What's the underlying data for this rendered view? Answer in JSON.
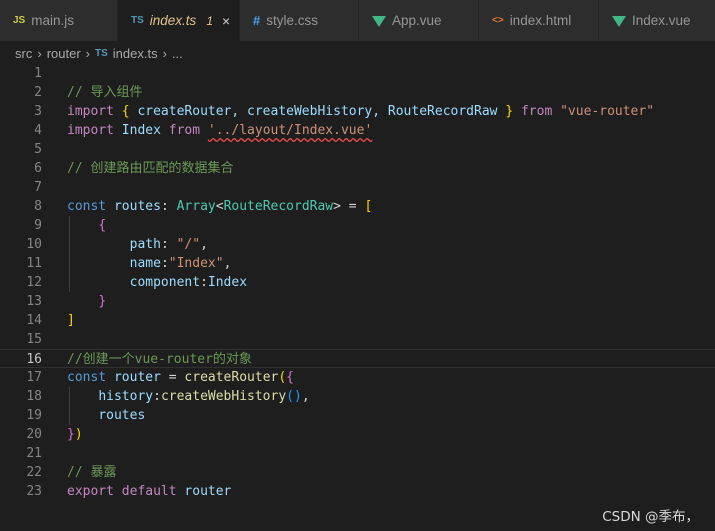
{
  "tabs": [
    {
      "icon": "JS",
      "icon_color": "#cbcb41",
      "label": "main.js",
      "width": 118
    },
    {
      "icon": "TS",
      "icon_color": "#519aba",
      "label": "index.ts",
      "modified": "1",
      "close": "×",
      "active": true,
      "width": 122
    },
    {
      "icon": "#",
      "icon_color": "#42a5f5",
      "label": "style.css",
      "width": 119
    },
    {
      "icon": "vue",
      "icon_color": "#41b883",
      "label": "App.vue",
      "width": 120
    },
    {
      "icon": "<>",
      "icon_color": "#e37933",
      "label": "index.html",
      "width": 120
    },
    {
      "icon": "vue",
      "icon_color": "#41b883",
      "label": "Index.vue",
      "width": 120
    }
  ],
  "breadcrumb": {
    "folder1": "src",
    "folder2": "router",
    "file_icon": "TS",
    "file": "index.ts",
    "tail": "..."
  },
  "editor": {
    "current_line": 16,
    "lines": [
      {
        "n": "1",
        "t": []
      },
      {
        "n": "2",
        "t": [
          [
            "// 导入组件",
            "cm"
          ]
        ]
      },
      {
        "n": "3",
        "t": [
          [
            "import",
            "kw"
          ],
          [
            " ",
            ""
          ],
          [
            "{",
            "br1"
          ],
          [
            " createRouter, createWebHistory, RouteRecordRaw ",
            "var"
          ],
          [
            "}",
            "br1"
          ],
          [
            " ",
            ""
          ],
          [
            "from",
            "kw"
          ],
          [
            " ",
            ""
          ],
          [
            "\"vue-router\"",
            "str"
          ]
        ]
      },
      {
        "n": "4",
        "t": [
          [
            "import",
            "kw"
          ],
          [
            " ",
            ""
          ],
          [
            "Index",
            "var"
          ],
          [
            " ",
            ""
          ],
          [
            "from",
            "kw"
          ],
          [
            " ",
            ""
          ],
          [
            "'../layout/Index.vue'",
            "str squiggle"
          ]
        ]
      },
      {
        "n": "5",
        "t": []
      },
      {
        "n": "6",
        "t": [
          [
            "// 创建路由匹配的数据集合",
            "cm"
          ]
        ]
      },
      {
        "n": "7",
        "t": []
      },
      {
        "n": "8",
        "t": [
          [
            "const",
            "bl"
          ],
          [
            " ",
            ""
          ],
          [
            "routes",
            "var"
          ],
          [
            ": ",
            ""
          ],
          [
            "Array",
            "ty"
          ],
          [
            "<",
            ""
          ],
          [
            "RouteRecordRaw",
            "ty"
          ],
          [
            "> = ",
            ""
          ],
          [
            "[",
            "br1"
          ]
        ]
      },
      {
        "n": "9",
        "t": [
          [
            "    ",
            ""
          ],
          [
            "{",
            "br2"
          ]
        ]
      },
      {
        "n": "10",
        "t": [
          [
            "        ",
            ""
          ],
          [
            "path",
            "var"
          ],
          [
            ": ",
            ""
          ],
          [
            "\"/\"",
            "str"
          ],
          [
            ",",
            ""
          ]
        ]
      },
      {
        "n": "11",
        "t": [
          [
            "        ",
            ""
          ],
          [
            "name",
            "var"
          ],
          [
            ":",
            ""
          ],
          [
            "\"Index\"",
            "str"
          ],
          [
            ",",
            ""
          ]
        ]
      },
      {
        "n": "12",
        "t": [
          [
            "        ",
            ""
          ],
          [
            "component",
            "var"
          ],
          [
            ":",
            ""
          ],
          [
            "Index",
            "var"
          ]
        ]
      },
      {
        "n": "13",
        "t": [
          [
            "    ",
            ""
          ],
          [
            "}",
            "br2"
          ]
        ]
      },
      {
        "n": "14",
        "t": [
          [
            "]",
            "br1"
          ]
        ]
      },
      {
        "n": "15",
        "t": []
      },
      {
        "n": "16",
        "t": [
          [
            "//创建一个vue-router的对象",
            "cm"
          ]
        ]
      },
      {
        "n": "17",
        "t": [
          [
            "const",
            "bl"
          ],
          [
            " ",
            ""
          ],
          [
            "router",
            "var"
          ],
          [
            " = ",
            ""
          ],
          [
            "createRouter",
            "fn"
          ],
          [
            "(",
            "br1"
          ],
          [
            "{",
            "br2"
          ]
        ]
      },
      {
        "n": "18",
        "t": [
          [
            "    ",
            ""
          ],
          [
            "history",
            "var"
          ],
          [
            ":",
            ""
          ],
          [
            "createWebHistory",
            "fn"
          ],
          [
            "()",
            "br3"
          ],
          [
            ",",
            ""
          ]
        ]
      },
      {
        "n": "19",
        "t": [
          [
            "    ",
            ""
          ],
          [
            "routes",
            "var"
          ]
        ]
      },
      {
        "n": "20",
        "t": [
          [
            "}",
            "br2"
          ],
          [
            ")",
            "br1"
          ]
        ]
      },
      {
        "n": "21",
        "t": []
      },
      {
        "n": "22",
        "t": [
          [
            "// 暴露",
            "cm"
          ]
        ]
      },
      {
        "n": "23",
        "t": [
          [
            "export",
            "kw"
          ],
          [
            " ",
            ""
          ],
          [
            "default",
            "kw"
          ],
          [
            " ",
            ""
          ],
          [
            "router",
            "var"
          ]
        ]
      }
    ]
  },
  "watermark": "CSDN @季布，"
}
